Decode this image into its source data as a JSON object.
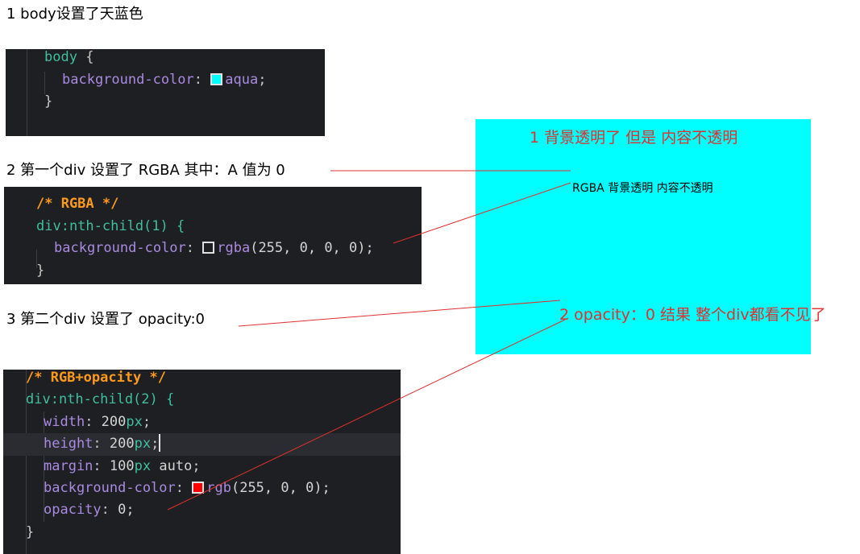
{
  "notes": {
    "body_note": "1 body设置了天蓝色",
    "rgba_note": "2 第一个div 设置了 RGBA 其中：A 值为 0",
    "opacity_note": "3 第二个div 设置了 opacity:0"
  },
  "code_body": {
    "selector": "body",
    "open": " {",
    "prop": "background-color",
    "colon": ": ",
    "value": "aqua",
    "semi": ";",
    "close": "}",
    "swatch_color": "#00ffff"
  },
  "code_rgba": {
    "comment": "/* RGBA */",
    "selector": "div:nth-child(1) {",
    "prop": "background-color",
    "colon": ": ",
    "fn": "rgba",
    "args": "(255, 0, 0, 0);",
    "close": "}",
    "swatch_color": "transparent"
  },
  "code_opacity": {
    "comment": "/* RGB+opacity */",
    "selector": "div:nth-child(2) {",
    "width_prop": "width",
    "width_num": "200",
    "height_prop": "height",
    "height_num": "200",
    "unit": "px",
    "margin_prop": "margin",
    "margin_num": "100",
    "margin_unit": "px",
    "margin_kw": "auto",
    "bg_prop": "background-color",
    "bg_fn": "rgb",
    "bg_args": "(255, 0, 0);",
    "opacity_prop": "opacity",
    "opacity_val": "0;",
    "close": "}",
    "swatch_color": "#ff0000"
  },
  "demo": {
    "background": "#00ffff",
    "label1": "1  背景透明了 但是 内容不透明",
    "label2": "RGBA 背景透明 内容不透明",
    "label3": "2 opacity：0  结果  整个div都看不见了",
    "annotation_color": "#e03030"
  }
}
